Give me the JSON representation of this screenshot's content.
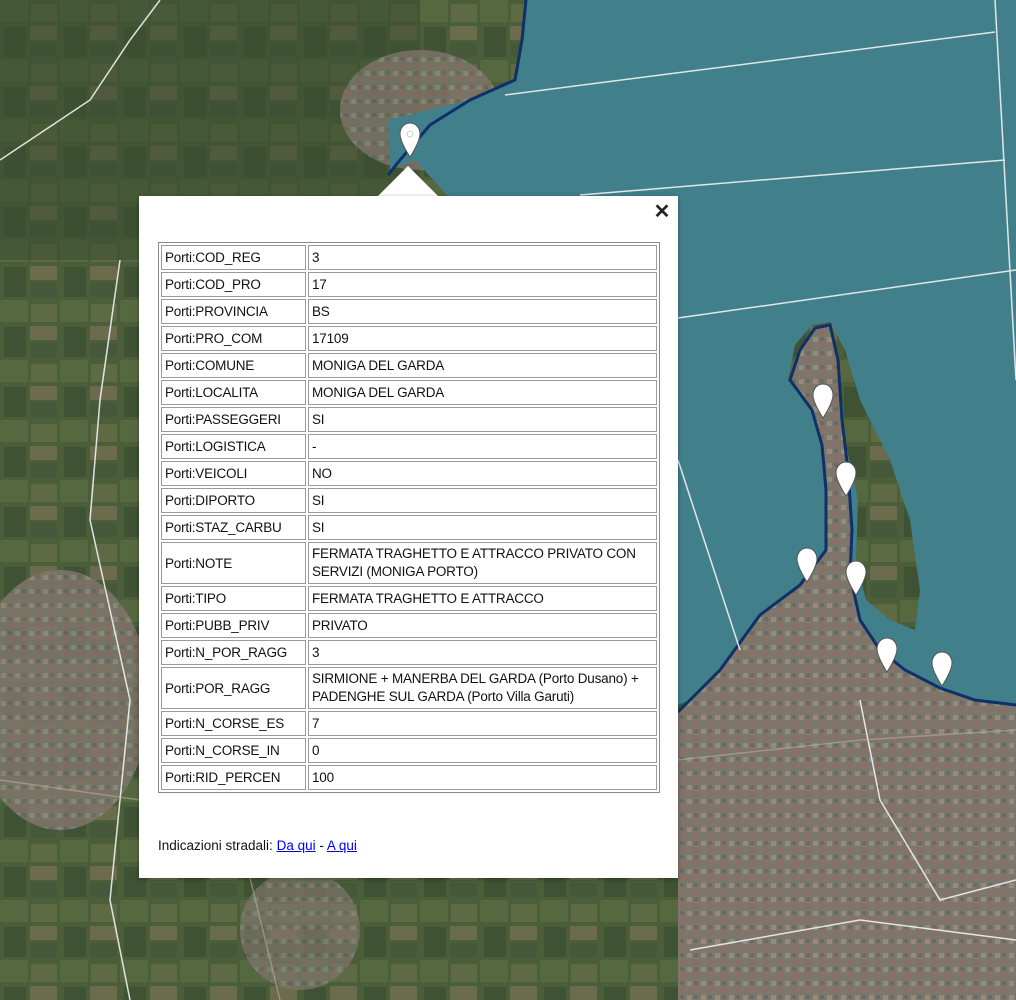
{
  "map": {
    "colors": {
      "lake": "#417f8b",
      "land": "#4a5d3a",
      "town": "#7c766a",
      "boundary": "#f2f2f2",
      "shore": "#10306a"
    }
  },
  "markers": [
    {
      "name": "marker-moniga",
      "icon": "map-pin-icon",
      "selected": true
    },
    {
      "name": "marker-sirmione-1",
      "icon": "map-pin-icon"
    },
    {
      "name": "marker-sirmione-2",
      "icon": "map-pin-icon"
    },
    {
      "name": "marker-sirmione-3",
      "icon": "map-pin-icon"
    },
    {
      "name": "marker-sirmione-4",
      "icon": "map-pin-icon"
    },
    {
      "name": "marker-sirmione-5",
      "icon": "map-pin-icon"
    },
    {
      "name": "marker-sirmione-6",
      "icon": "map-pin-icon"
    }
  ],
  "infowindow": {
    "close_icon": "close-icon",
    "close_glyph": "✕",
    "rows": [
      {
        "key": "Porti:COD_REG",
        "value": "3"
      },
      {
        "key": "Porti:COD_PRO",
        "value": "17"
      },
      {
        "key": "Porti:PROVINCIA",
        "value": "BS"
      },
      {
        "key": "Porti:PRO_COM",
        "value": "17109"
      },
      {
        "key": "Porti:COMUNE",
        "value": "MONIGA DEL GARDA"
      },
      {
        "key": "Porti:LOCALITA",
        "value": "MONIGA DEL GARDA"
      },
      {
        "key": "Porti:PASSEGGERI",
        "value": "SI"
      },
      {
        "key": "Porti:LOGISTICA",
        "value": "-"
      },
      {
        "key": "Porti:VEICOLI",
        "value": "NO"
      },
      {
        "key": "Porti:DIPORTO",
        "value": "SI"
      },
      {
        "key": "Porti:STAZ_CARBU",
        "value": "SI"
      },
      {
        "key": "Porti:NOTE",
        "value": "FERMATA TRAGHETTO E ATTRACCO PRIVATO CON SERVIZI (MONIGA PORTO)"
      },
      {
        "key": "Porti:TIPO",
        "value": "FERMATA TRAGHETTO E ATTRACCO"
      },
      {
        "key": "Porti:PUBB_PRIV",
        "value": "PRIVATO"
      },
      {
        "key": "Porti:N_POR_RAGG",
        "value": "3"
      },
      {
        "key": "Porti:POR_RAGG",
        "value": "SIRMIONE + MANERBA DEL GARDA (Porto Dusano) + PADENGHE SUL GARDA (Porto Villa Garuti)"
      },
      {
        "key": "Porti:N_CORSE_ES",
        "value": "7"
      },
      {
        "key": "Porti:N_CORSE_IN",
        "value": "0"
      },
      {
        "key": "Porti:RID_PERCEN",
        "value": "100"
      }
    ],
    "directions": {
      "label": "Indicazioni stradali:",
      "from_here": "Da qui",
      "separator": "-",
      "to_here": "A qui"
    }
  }
}
